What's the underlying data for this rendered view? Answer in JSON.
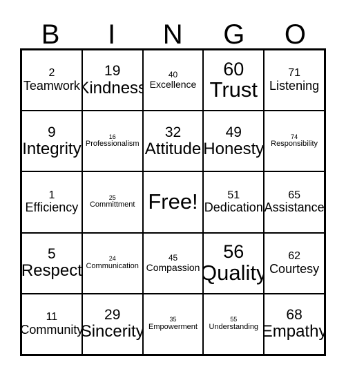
{
  "header": {
    "letters": [
      "B",
      "I",
      "N",
      "G",
      "O"
    ]
  },
  "grid": {
    "rows": [
      [
        {
          "number": "2",
          "word": "Teamwork",
          "size": "md"
        },
        {
          "number": "19",
          "word": "Kindness",
          "size": "lg"
        },
        {
          "number": "40",
          "word": "Excellence",
          "size": "sm"
        },
        {
          "number": "60",
          "word": "Trust",
          "size": "xl"
        },
        {
          "number": "71",
          "word": "Listening",
          "size": "md"
        }
      ],
      [
        {
          "number": "9",
          "word": "Integrity",
          "size": "lg"
        },
        {
          "number": "16",
          "word": "Professionalism",
          "size": "xs"
        },
        {
          "number": "32",
          "word": "Attitude",
          "size": "lg"
        },
        {
          "number": "49",
          "word": "Honesty",
          "size": "lg"
        },
        {
          "number": "74",
          "word": "Responsibility",
          "size": "xs"
        }
      ],
      [
        {
          "number": "1",
          "word": "Efficiency",
          "size": "md"
        },
        {
          "number": "25",
          "word": "Committment",
          "size": "xs"
        },
        {
          "number": "",
          "word": "Free!",
          "size": "xl",
          "free": true
        },
        {
          "number": "51",
          "word": "Dedication",
          "size": "md"
        },
        {
          "number": "65",
          "word": "Assistance",
          "size": "md"
        }
      ],
      [
        {
          "number": "5",
          "word": "Respect",
          "size": "lg"
        },
        {
          "number": "24",
          "word": "Communication",
          "size": "xs"
        },
        {
          "number": "45",
          "word": "Compassion",
          "size": "sm"
        },
        {
          "number": "56",
          "word": "Quality",
          "size": "xl"
        },
        {
          "number": "62",
          "word": "Courtesy",
          "size": "md"
        }
      ],
      [
        {
          "number": "11",
          "word": "Community",
          "size": "md"
        },
        {
          "number": "29",
          "word": "Sincerity",
          "size": "lg"
        },
        {
          "number": "35",
          "word": "Empowerment",
          "size": "xs"
        },
        {
          "number": "55",
          "word": "Understanding",
          "size": "xs"
        },
        {
          "number": "68",
          "word": "Empathy",
          "size": "lg"
        }
      ]
    ]
  }
}
